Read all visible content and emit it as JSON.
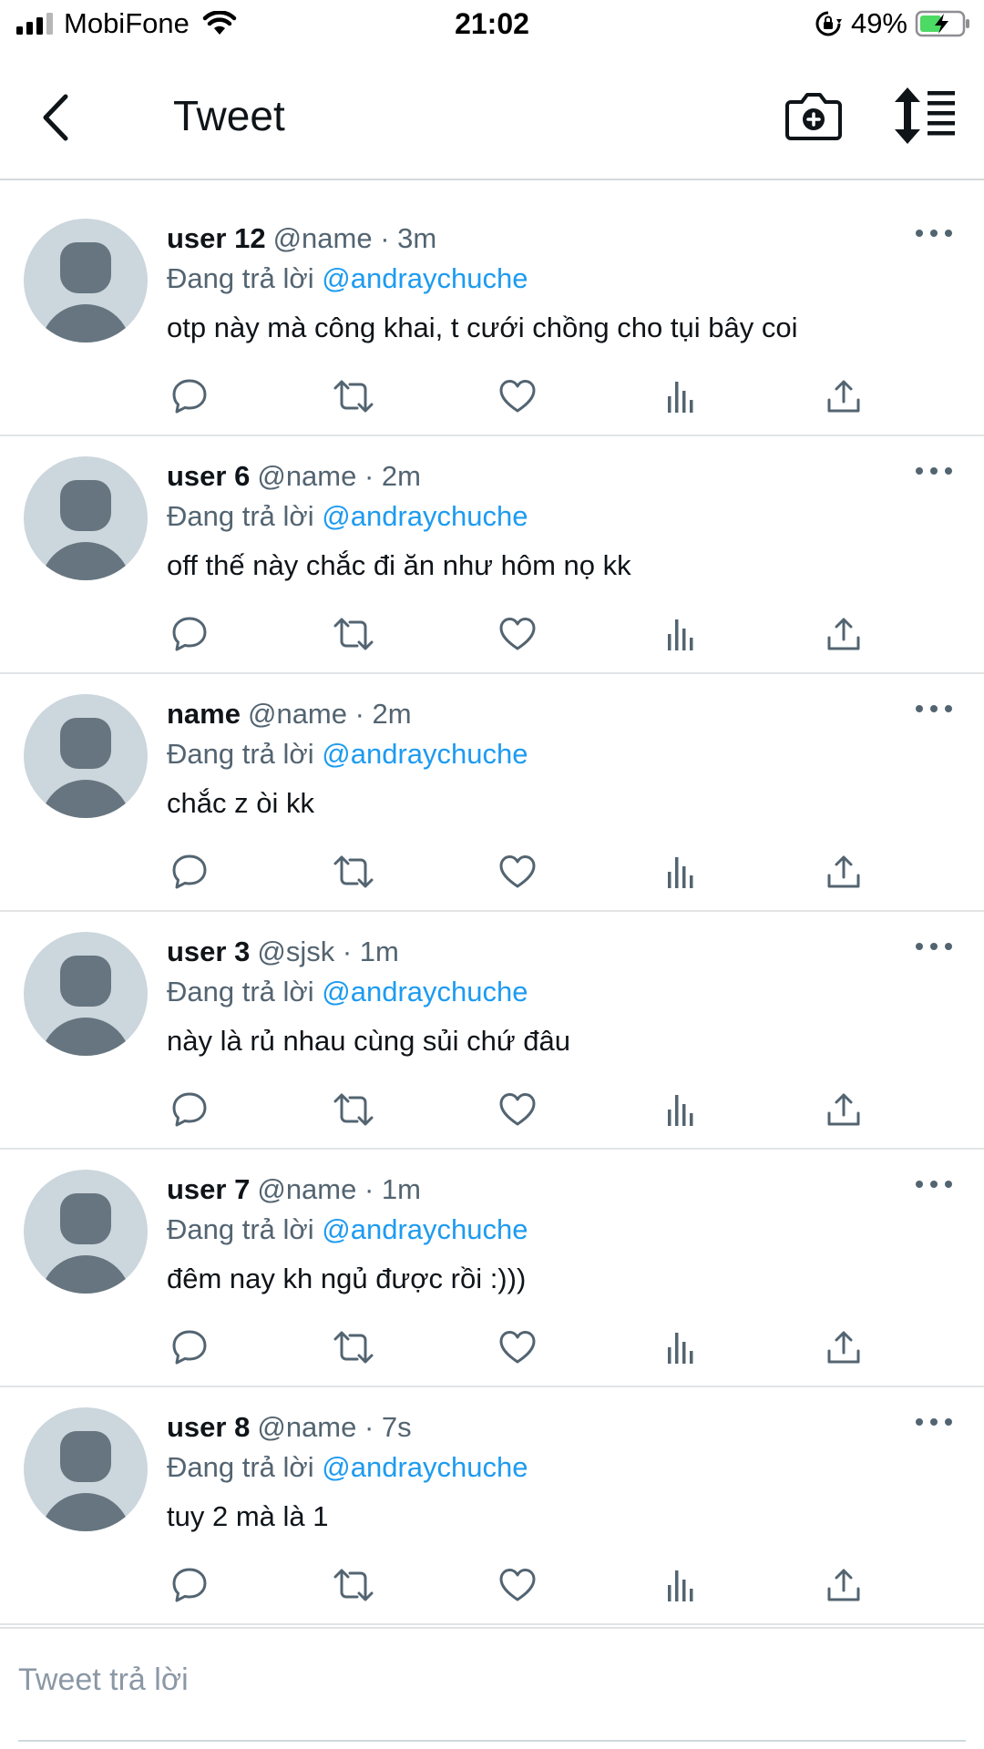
{
  "status_bar": {
    "carrier": "MobiFone",
    "time": "21:02",
    "battery": "49%"
  },
  "nav": {
    "title": "Tweet"
  },
  "icons": {
    "back": "chevron-left-icon",
    "camera": "camera-plus-icon",
    "sort": "sort-lines-icon",
    "reply": "reply-icon",
    "retweet": "retweet-icon",
    "like": "heart-icon",
    "stats": "stats-icon",
    "share": "share-icon"
  },
  "colors": {
    "accent": "#1d9bf0",
    "secondary_text": "#536471",
    "avatar_bg": "#ccd6dd",
    "avatar_fg": "#66757f"
  },
  "tweets": [
    {
      "name": "user 12",
      "meta": "@name · 3m",
      "reply_prefix": "Đang trả lời",
      "reply_handle": "@andraychuche",
      "text": "otp này mà công khai, t cưới chồng cho tụi bây coi"
    },
    {
      "name": "user 6",
      "meta": "@name · 2m",
      "reply_prefix": "Đang trả lời",
      "reply_handle": "@andraychuche",
      "text": "off thế này chắc đi ăn như hôm nọ kk"
    },
    {
      "name": "name",
      "meta": "@name · 2m",
      "reply_prefix": "Đang trả lời",
      "reply_handle": "@andraychuche",
      "text": "chắc z òi kk"
    },
    {
      "name": "user 3",
      "meta": "@sjsk · 1m",
      "reply_prefix": "Đang trả lời",
      "reply_handle": "@andraychuche",
      "text": "này là rủ nhau cùng sủi chứ đâu"
    },
    {
      "name": "user 7",
      "meta": "@name · 1m",
      "reply_prefix": "Đang trả lời",
      "reply_handle": "@andraychuche",
      "text": "đêm nay kh ngủ được rồi :)))"
    },
    {
      "name": "user 8",
      "meta": "@name · 7s",
      "reply_prefix": "Đang trả lời",
      "reply_handle": "@andraychuche",
      "text": "tuy 2 mà là 1"
    }
  ],
  "reply_box": {
    "placeholder": "Tweet trả lời"
  }
}
